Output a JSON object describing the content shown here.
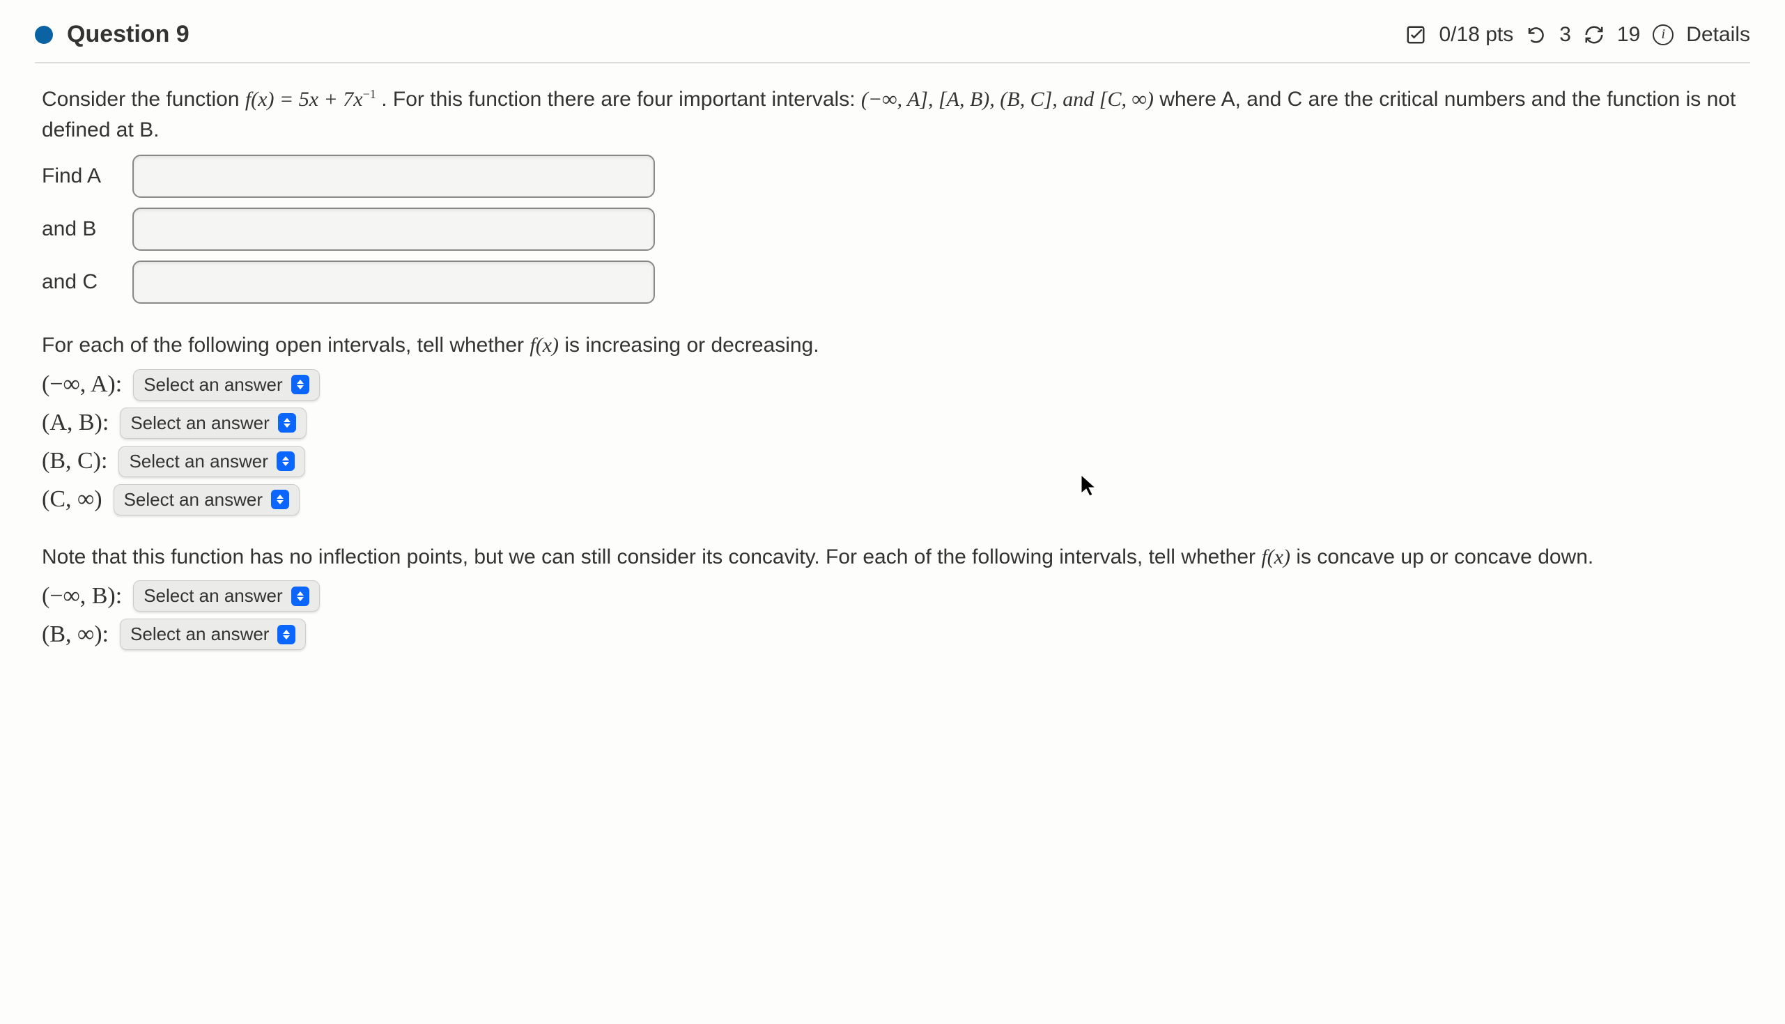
{
  "header": {
    "question_label": "Question 9",
    "points": "0/18 pts",
    "attempts": "3",
    "retries": "19",
    "details_label": "Details"
  },
  "body": {
    "intro_part1": "Consider the function ",
    "function_text": "f(x) = 5x + 7x",
    "function_exp": "−1",
    "intro_part2": ". For this function there are four important intervals: ",
    "interval_list": "(−∞, A], [A, B), (B, C], and [C, ∞)",
    "intro_part3": " where A, and C are the critical numbers and the function is not defined at B.",
    "find_a_label": "Find A",
    "find_b_label": "and B",
    "find_c_label": "and C",
    "monotone_prompt_part1": "For each of the following open intervals, tell whether ",
    "fx": "f(x)",
    "monotone_prompt_part2": " is increasing or decreasing.",
    "concave_prompt_part1": "Note that this function has no inflection points, but we can still consider its concavity. For each of the following intervals, tell whether ",
    "concave_prompt_part2": " is concave up or concave down."
  },
  "intervals_monotone": [
    {
      "label": "(−∞, A):",
      "name": "neg-inf-to-a"
    },
    {
      "label": "(A, B):",
      "name": "a-to-b"
    },
    {
      "label": "(B, C):",
      "name": "b-to-c"
    },
    {
      "label": "(C, ∞)",
      "name": "c-to-inf"
    }
  ],
  "intervals_concave": [
    {
      "label": "(−∞, B):",
      "name": "neg-inf-to-b"
    },
    {
      "label": "(B, ∞):",
      "name": "b-to-inf"
    }
  ],
  "select_placeholder": "Select an answer",
  "inputs": {
    "A": "",
    "B": "",
    "C": ""
  }
}
